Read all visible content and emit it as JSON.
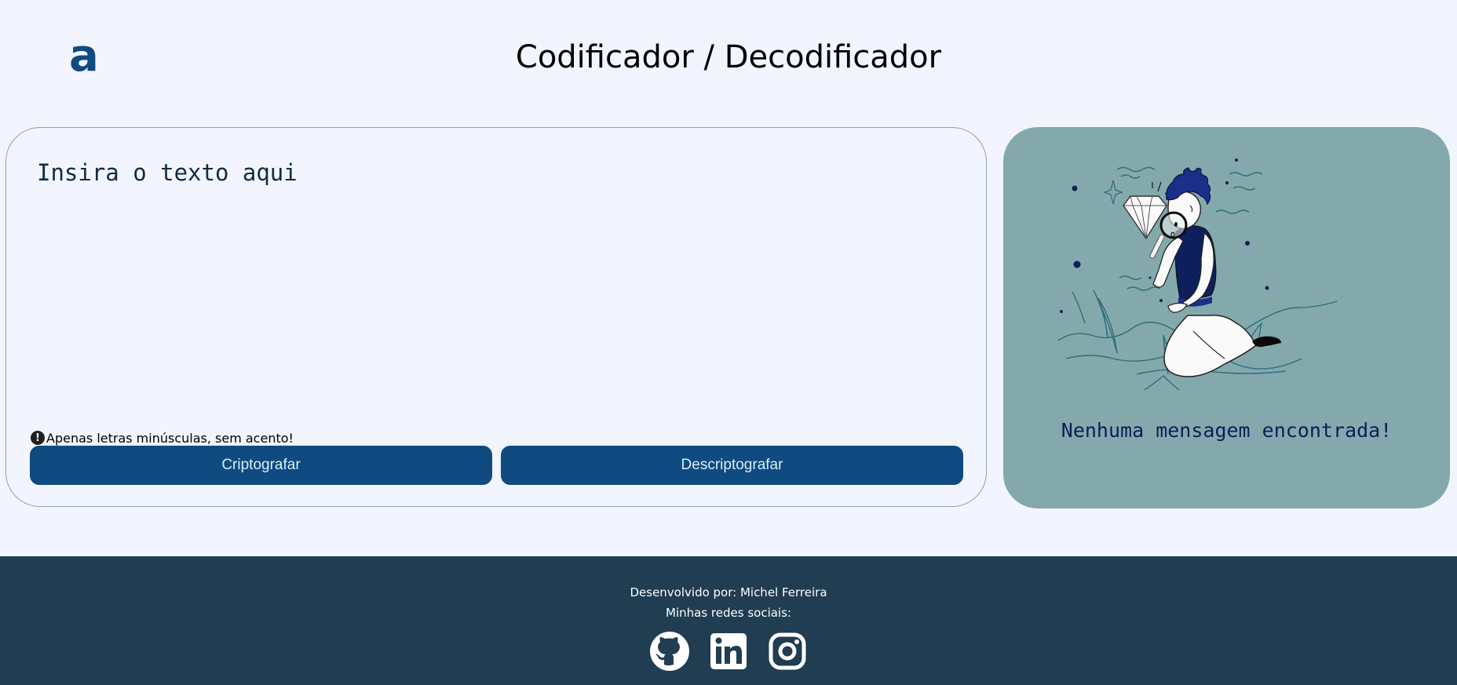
{
  "header": {
    "logo_text": "a",
    "title": "Codificador / Decodificador"
  },
  "input": {
    "placeholder": "Insira o texto aqui",
    "hint_icon": "!",
    "hint": "Apenas letras minúsculas, sem acento!"
  },
  "buttons": {
    "encrypt_label": "Criptografar",
    "decrypt_label": "Descriptografar"
  },
  "output": {
    "illustration": "person-with-magnifier-and-diamond",
    "empty_message": "Nenhuma mensagem encontrada!"
  },
  "footer": {
    "developed_by": "Desenvolvido por: Michel Ferreira",
    "social_label": "Minhas redes sociais:",
    "socials": [
      "github-icon",
      "linkedin-icon",
      "instagram-icon"
    ]
  },
  "colors": {
    "background": "#f2f5fd",
    "brand": "#0f4a80",
    "output_panel": "#84a9ad",
    "footer": "#203d51",
    "message_text": "#0a1f55"
  }
}
